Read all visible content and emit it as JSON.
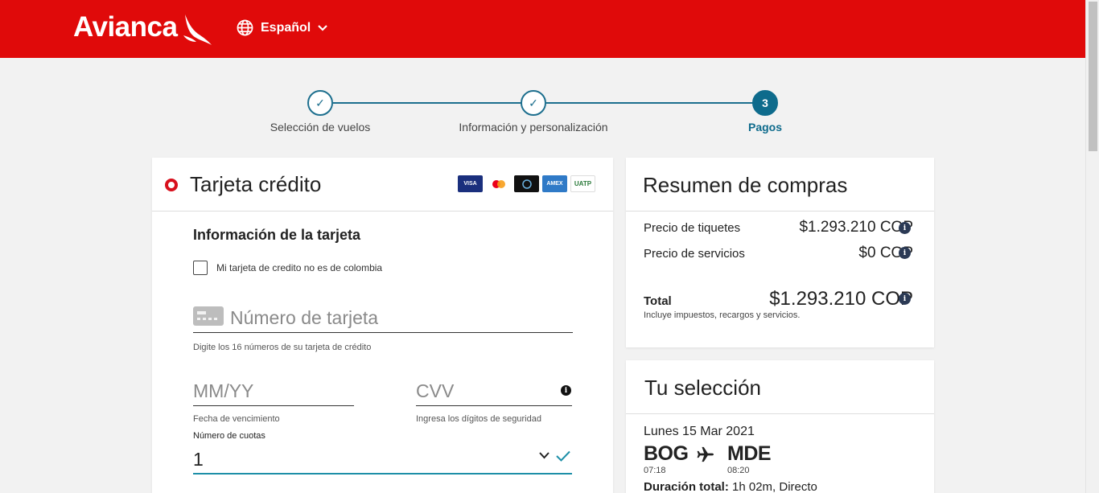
{
  "header": {
    "brand": "Avianca",
    "language": "Español",
    "colors": {
      "brand_red": "#e00a0a",
      "accent_teal": "#0e6b8c"
    }
  },
  "stepper": {
    "steps": [
      {
        "label": "Selección de vuelos",
        "state": "done"
      },
      {
        "label": "Información y personalización",
        "state": "done"
      },
      {
        "label": "Pagos",
        "state": "active",
        "number": "3"
      }
    ]
  },
  "payment": {
    "method_title": "Tarjeta crédito",
    "card_brands": [
      "VISA",
      "mastercard",
      "diners",
      "AMEX",
      "UATP"
    ],
    "section_title": "Información de la tarjeta",
    "foreign_card_label": "Mi tarjeta de credito no es de colombia",
    "card_number_placeholder": "Número de tarjeta",
    "card_number_help": "Digite los 16 números de su tarjeta de crédito",
    "expiry_placeholder": "MM/YY",
    "expiry_help": "Fecha de vencimiento",
    "cvv_placeholder": "CVV",
    "cvv_help": "Ingresa los dígitos de seguridad",
    "installments_label": "Número de cuotas",
    "installments_value": "1"
  },
  "summary": {
    "title": "Resumen de compras",
    "tickets_label": "Precio de tiquetes",
    "tickets_amount": "$1.293.210 COP",
    "services_label": "Precio de servicios",
    "services_amount": "$0 COP",
    "total_label": "Total",
    "total_amount": "$1.293.210 COP",
    "total_note": "Incluye impuestos, recargos y servicios."
  },
  "selection": {
    "title": "Tu selección",
    "date": "Lunes 15 Mar 2021",
    "origin": "BOG",
    "origin_time": "07:18",
    "destination": "MDE",
    "destination_time": "08:20",
    "duration_label": "Duración total:",
    "duration_value": "1h 02m, Directo"
  }
}
